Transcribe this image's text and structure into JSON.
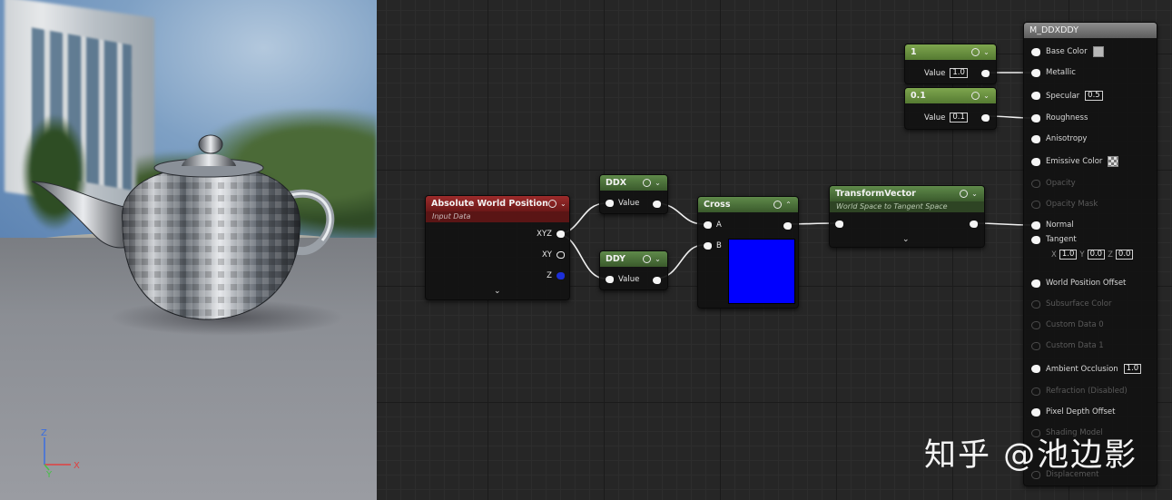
{
  "viewport": {
    "axes": {
      "z": "Z",
      "x": "X",
      "y": "Y"
    }
  },
  "nodes": {
    "abs_world_pos": {
      "title": "Absolute World Position",
      "subtitle": "Input Data",
      "outputs": [
        "XYZ",
        "XY",
        "Z"
      ]
    },
    "ddx": {
      "title": "DDX",
      "input": "Value"
    },
    "ddy": {
      "title": "DDY",
      "input": "Value"
    },
    "cross": {
      "title": "Cross",
      "inputs": [
        "A",
        "B"
      ],
      "preview_color": "#0000ff"
    },
    "transform": {
      "title": "TransformVector",
      "subtitle": "World Space to Tangent Space"
    },
    "const1": {
      "title": "1",
      "label": "Value",
      "value": "1.0"
    },
    "const2": {
      "title": "0.1",
      "label": "Value",
      "value": "0.1"
    }
  },
  "material": {
    "title": "M_DDXDDY",
    "pins": [
      {
        "label": "Base Color",
        "enabled": true,
        "extra": "swatch-gray"
      },
      {
        "label": "Metallic",
        "enabled": true
      },
      {
        "label": "Specular",
        "enabled": true,
        "value": "0.5"
      },
      {
        "label": "Roughness",
        "enabled": true
      },
      {
        "label": "Anisotropy",
        "enabled": true
      },
      {
        "label": "Emissive Color",
        "enabled": true,
        "extra": "swatch-checker"
      },
      {
        "label": "Opacity",
        "enabled": false
      },
      {
        "label": "Opacity Mask",
        "enabled": false
      },
      {
        "label": "Normal",
        "enabled": true
      },
      {
        "label": "Tangent",
        "enabled": true,
        "xyz": [
          "1.0",
          "0.0",
          "0.0"
        ]
      },
      {
        "label": "World Position Offset",
        "enabled": true
      },
      {
        "label": "Subsurface Color",
        "enabled": false
      },
      {
        "label": "Custom Data 0",
        "enabled": false
      },
      {
        "label": "Custom Data 1",
        "enabled": false
      },
      {
        "label": "Ambient Occlusion",
        "enabled": true,
        "value": "1.0"
      },
      {
        "label": "Refraction (Disabled)",
        "enabled": false
      },
      {
        "label": "Pixel Depth Offset",
        "enabled": true
      },
      {
        "label": "Shading Model",
        "enabled": false
      },
      {
        "label": "Displacement",
        "enabled": false
      }
    ],
    "tangent_axes": [
      "X",
      "Y",
      "Z"
    ]
  },
  "watermark": "知乎 @池边影",
  "colors": {
    "cross_preview": "#0000ff",
    "grid_bg": "#262626"
  }
}
